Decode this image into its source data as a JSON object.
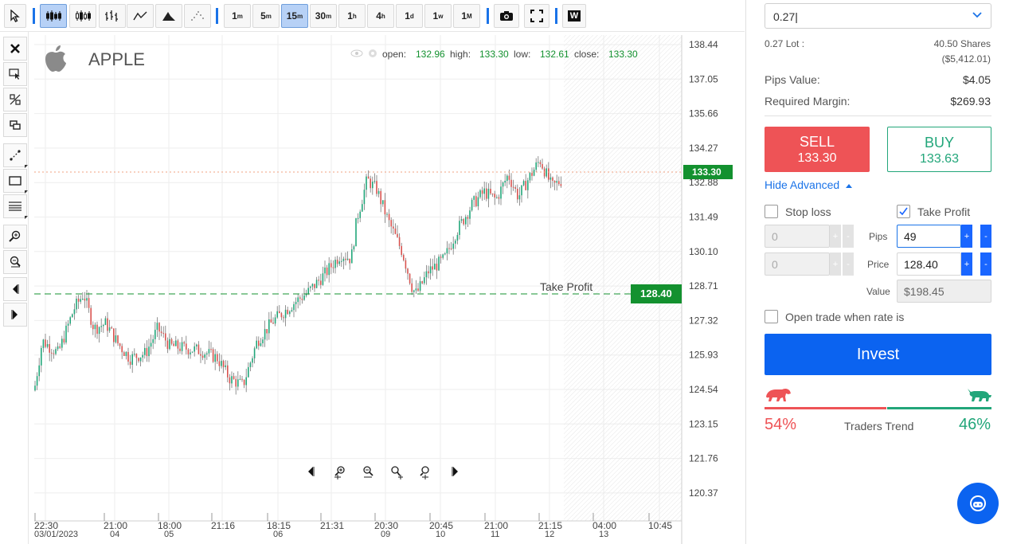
{
  "toolbar": {
    "timeframes": [
      {
        "base": "1",
        "sup": "m"
      },
      {
        "base": "5",
        "sup": "m"
      },
      {
        "base": "15",
        "sup": "m"
      },
      {
        "base": "30",
        "sup": "m"
      },
      {
        "base": "1",
        "sup": "h"
      },
      {
        "base": "4",
        "sup": "h"
      },
      {
        "base": "1",
        "sup": "d"
      },
      {
        "base": "1",
        "sup": "w"
      },
      {
        "base": "1",
        "sup": "M"
      }
    ],
    "active_timeframe": "15m",
    "w_label": "W"
  },
  "chart": {
    "symbol": "APPLE",
    "ohlc": {
      "open_label": "open:",
      "open": "132.96",
      "high_label": "high:",
      "high": "133.30",
      "low_label": "low:",
      "low": "132.61",
      "close_label": "close:",
      "close": "133.30"
    },
    "y_ticks": [
      "138.44",
      "137.05",
      "135.66",
      "134.27",
      "132.88",
      "131.49",
      "130.10",
      "128.71",
      "127.32",
      "125.93",
      "124.54",
      "123.15",
      "121.76",
      "120.37"
    ],
    "current_price_tag": "133.30",
    "take_profit_label": "Take Profit",
    "take_profit_tag": "128.40",
    "x_ticks": [
      {
        "time": "22:30",
        "date": "03/01/2023"
      },
      {
        "time": "21:00",
        "date": "04"
      },
      {
        "time": "18:00",
        "date": "05"
      },
      {
        "time": "21:16",
        "date": ""
      },
      {
        "time": "18:15",
        "date": "06"
      },
      {
        "time": "21:31",
        "date": ""
      },
      {
        "time": "20:30",
        "date": "09"
      },
      {
        "time": "20:45",
        "date": "10"
      },
      {
        "time": "21:00",
        "date": "11"
      },
      {
        "time": "21:15",
        "date": "12"
      },
      {
        "time": "04:00",
        "date": "13"
      },
      {
        "time": "10:45",
        "date": ""
      }
    ],
    "colors": {
      "up": "#22a67a",
      "down": "#d9534f",
      "tag_green": "#13912f",
      "grid": "#eeeeee"
    }
  },
  "panel": {
    "lot_value": "0.27",
    "lot_label": "0.27 Lot :",
    "shares": "40.50 Shares",
    "shares_value": "($5,412.01)",
    "pips_value_label": "Pips Value:",
    "pips_value": "$4.05",
    "margin_label": "Required Margin:",
    "margin_value": "$269.93",
    "sell_label": "SELL",
    "sell_price": "133.30",
    "buy_label": "BUY",
    "buy_price": "133.63",
    "hide_advanced": "Hide Advanced",
    "stop_loss_label": "Stop loss",
    "take_profit_label": "Take Profit",
    "sl_pips": "0",
    "sl_price": "0",
    "pips_label": "Pips",
    "price_label": "Price",
    "tp_pips": "49",
    "tp_price": "128.40",
    "value_label": "Value",
    "tp_value": "$198.45",
    "open_when_label": "Open trade when rate is",
    "invest_label": "Invest",
    "sell_pct": "54%",
    "buy_pct": "46%",
    "trend_label": "Traders Trend"
  }
}
